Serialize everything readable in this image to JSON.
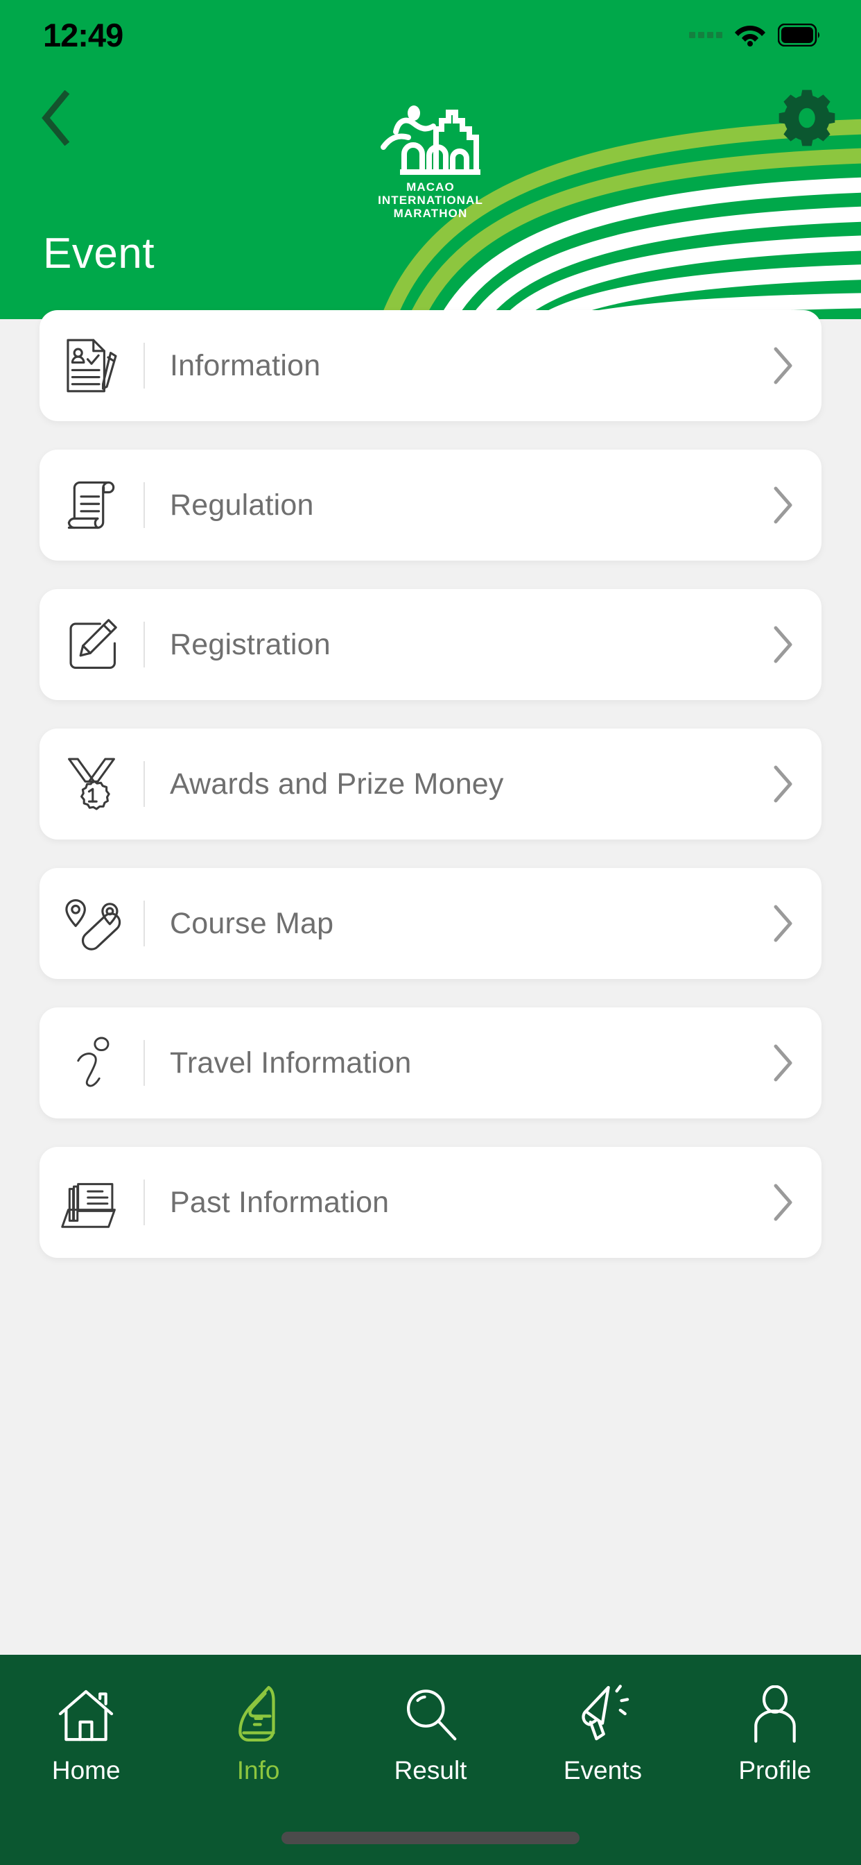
{
  "status_bar": {
    "time": "12:49",
    "signal_icon": "signal-dots-icon",
    "wifi_icon": "wifi-icon",
    "battery_icon": "battery-icon"
  },
  "header": {
    "back_icon": "back-chevron-icon",
    "settings_icon": "gear-icon",
    "brand": {
      "logo_icon": "macao-marathon-logo-icon",
      "line1": "MACAO",
      "line2": "INTERNATIONAL",
      "line3": "MARATHON"
    },
    "title": "Event",
    "colors": {
      "primary_green": "#00A84A",
      "light_stripe": "#8DC63F",
      "dark_green": "#0B5730"
    }
  },
  "menu": {
    "items": [
      {
        "label": "Information",
        "icon": "document-person-check-pencil-icon",
        "chevron": "chevron-right-icon"
      },
      {
        "label": "Regulation",
        "icon": "scroll-icon",
        "chevron": "chevron-right-icon"
      },
      {
        "label": "Registration",
        "icon": "edit-square-pencil-icon",
        "chevron": "chevron-right-icon"
      },
      {
        "label": "Awards and Prize Money",
        "icon": "medal-first-place-icon",
        "chevron": "chevron-right-icon"
      },
      {
        "label": "Course Map",
        "icon": "route-map-pins-icon",
        "chevron": "chevron-right-icon"
      },
      {
        "label": "Travel Information",
        "icon": "italic-info-i-icon",
        "chevron": "chevron-right-icon"
      },
      {
        "label": "Past Information",
        "icon": "folder-documents-icon",
        "chevron": "chevron-right-icon"
      }
    ]
  },
  "tabbar": {
    "active": "Info",
    "active_color": "#8DC63F",
    "items": [
      {
        "label": "Home",
        "icon": "house-icon",
        "active": false
      },
      {
        "label": "Info",
        "icon": "running-shoe-icon",
        "active": true
      },
      {
        "label": "Result",
        "icon": "magnifier-icon",
        "active": false
      },
      {
        "label": "Events",
        "icon": "megaphone-icon",
        "active": false
      },
      {
        "label": "Profile",
        "icon": "person-icon",
        "active": false
      }
    ]
  }
}
